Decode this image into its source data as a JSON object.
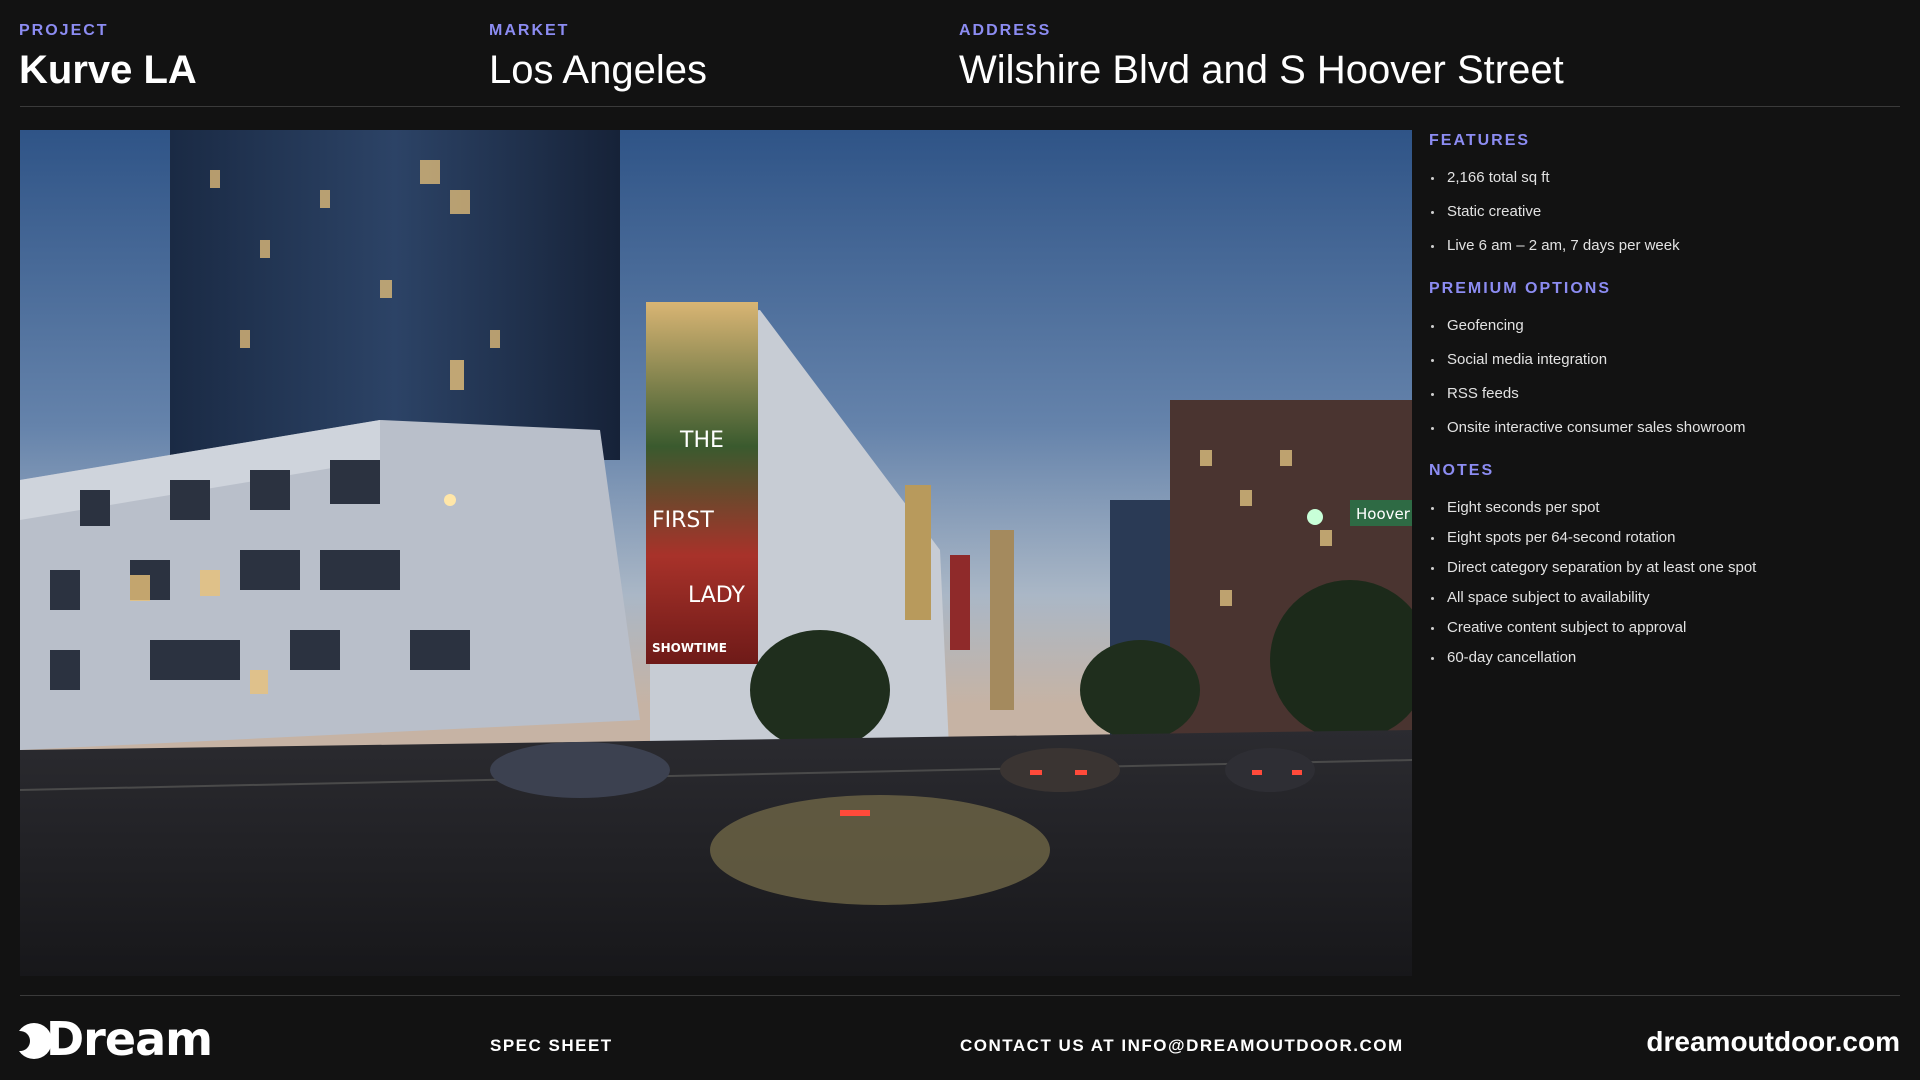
{
  "header": {
    "project_label": "PROJECT",
    "project_value": "Kurve LA",
    "market_label": "MARKET",
    "market_value": "Los Angeles",
    "address_label": "ADDRESS",
    "address_value": "Wilshire Blvd and S Hoover Street"
  },
  "photo": {
    "billboard_lines": [
      "THE",
      "FIRST",
      "LADY"
    ],
    "billboard_brand": "SHOWTIME",
    "street_sign": "Hoover"
  },
  "features": {
    "title": "FEATURES",
    "items": [
      "2,166 total sq ft",
      "Static creative",
      "Live 6 am – 2 am, 7 days per week"
    ]
  },
  "premium": {
    "title": "PREMIUM OPTIONS",
    "items": [
      "Geofencing",
      "Social media integration",
      "RSS feeds",
      "Onsite interactive consumer sales showroom"
    ]
  },
  "notes": {
    "title": "NOTES",
    "items": [
      "Eight seconds per spot",
      "Eight spots per 64-second rotation",
      "Direct category separation by at least one spot",
      "All space subject to availability",
      "Creative content subject to approval",
      "60-day cancellation"
    ]
  },
  "footer": {
    "logo": "Dream",
    "spec_label": "SPEC SHEET",
    "contact_label": "CONTACT US AT INFO@DREAMOUTDOOR.COM",
    "website": "dreamoutdoor.com"
  },
  "colors": {
    "background": "#121212",
    "accent": "#8c8cf2",
    "text": "#ffffff"
  }
}
